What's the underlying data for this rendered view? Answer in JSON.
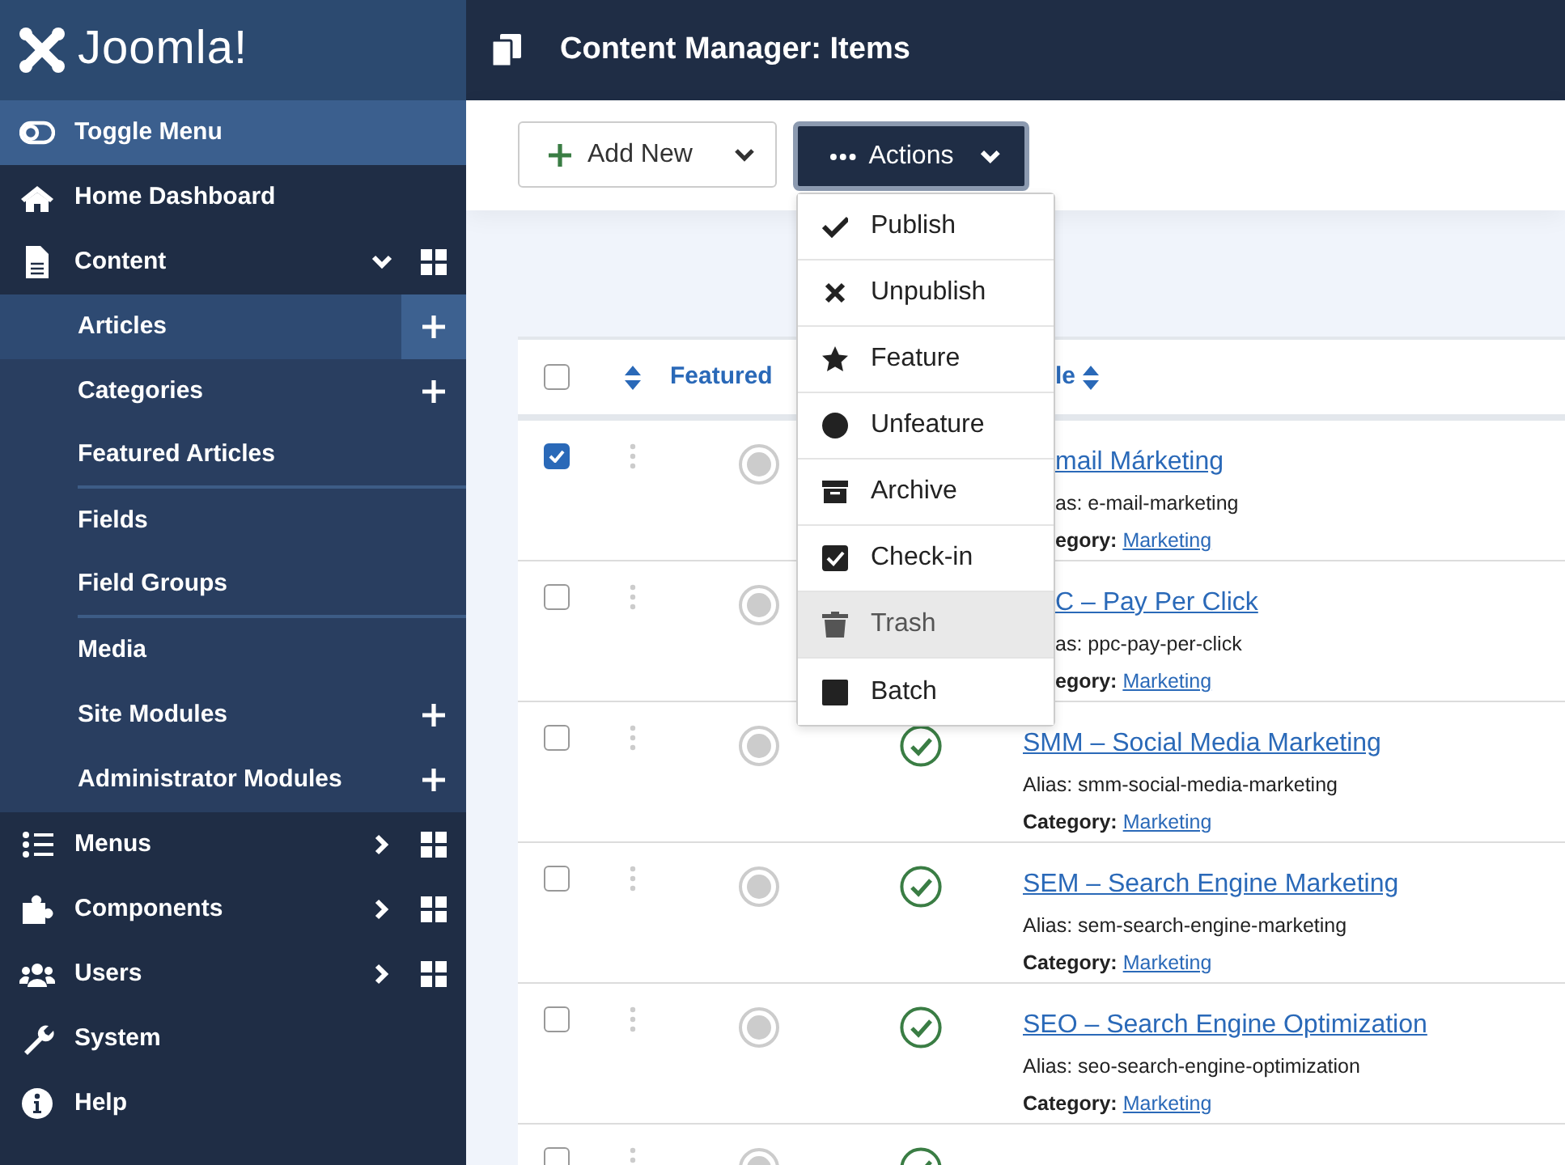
{
  "brand": {
    "name": "Joomla!"
  },
  "sidebar": {
    "items": [
      {
        "kind": "toggle",
        "label": "Toggle Menu"
      },
      {
        "kind": "item",
        "label": "Home Dashboard"
      },
      {
        "kind": "item",
        "label": "Content",
        "expanded": true,
        "dashboard": true,
        "children": [
          {
            "label": "Articles",
            "selected": true,
            "add": true,
            "divider_after": false
          },
          {
            "label": "Categories",
            "selected": false,
            "add": true,
            "divider_after": false
          },
          {
            "label": "Featured Articles",
            "selected": false,
            "add": false,
            "divider_after": true
          },
          {
            "label": "Fields",
            "selected": false,
            "add": false,
            "divider_after": false
          },
          {
            "label": "Field Groups",
            "selected": false,
            "add": false,
            "divider_after": true
          },
          {
            "label": "Media",
            "selected": false,
            "add": false,
            "divider_after": false
          },
          {
            "label": "Site Modules",
            "selected": false,
            "add": true,
            "divider_after": false
          },
          {
            "label": "Administrator Modules",
            "selected": false,
            "add": true,
            "divider_after": false
          }
        ]
      },
      {
        "kind": "item",
        "label": "Menus",
        "expanded": false,
        "dashboard": true
      },
      {
        "kind": "item",
        "label": "Components",
        "expanded": false,
        "dashboard": true
      },
      {
        "kind": "item",
        "label": "Users",
        "expanded": false,
        "dashboard": true
      },
      {
        "kind": "item",
        "label": "System"
      },
      {
        "kind": "item",
        "label": "Help"
      }
    ]
  },
  "header": {
    "title": "Content Manager: Items"
  },
  "toolbar": {
    "add_new": "Add New",
    "actions": "Actions"
  },
  "actions_menu": [
    {
      "label": "Publish",
      "selected": false
    },
    {
      "label": "Unpublish",
      "selected": false
    },
    {
      "label": "Feature",
      "selected": false
    },
    {
      "label": "Unfeature",
      "selected": false
    },
    {
      "label": "Archive",
      "selected": false
    },
    {
      "label": "Check-in",
      "selected": false
    },
    {
      "label": "Trash",
      "selected": true
    },
    {
      "label": "Batch",
      "selected": false
    }
  ],
  "table": {
    "select_all": {
      "checked": false
    },
    "columns": {
      "featured": "Featured",
      "column_4": "le"
    },
    "rows": [
      {
        "selected": true,
        "featured": false,
        "title": "mail Márketing",
        "alias": "as: e-mail-marketing",
        "category_label": "egory:",
        "category": "Marketing"
      },
      {
        "selected": false,
        "featured": false,
        "title": "C – Pay Per Click",
        "alias": "as: ppc-pay-per-click",
        "category_label": "egory:",
        "category": "Marketing"
      },
      {
        "selected": false,
        "featured": false,
        "published": true,
        "title": "SMM – Social Media Marketing",
        "alias": "Alias: smm-social-media-marketing",
        "category_label": "Category:",
        "category": "Marketing"
      },
      {
        "selected": false,
        "featured": false,
        "published": true,
        "title": "SEM – Search Engine Marketing",
        "alias": "Alias: sem-search-engine-marketing",
        "category_label": "Category:",
        "category": "Marketing"
      },
      {
        "selected": false,
        "featured": false,
        "published": true,
        "title": "SEO – Search Engine Optimization",
        "alias": "Alias: seo-search-engine-optimization",
        "category_label": "Category:",
        "category": "Marketing"
      },
      {
        "selected": false,
        "featured": false,
        "published": true
      }
    ]
  }
}
